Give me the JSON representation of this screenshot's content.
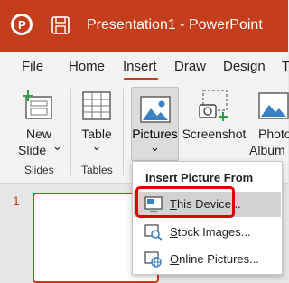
{
  "window": {
    "title": "Presentation1  -  PowerPoint"
  },
  "tabs": [
    {
      "label": "File"
    },
    {
      "label": "Home"
    },
    {
      "label": "Insert"
    },
    {
      "label": "Draw"
    },
    {
      "label": "Design"
    },
    {
      "label": "T"
    }
  ],
  "ribbon": {
    "new_slide": {
      "line1": "New",
      "line2": "Slide",
      "chevron": "⌄"
    },
    "table": {
      "label": "Table",
      "chevron": "⌄"
    },
    "pictures": {
      "label": "Pictures",
      "chevron": "⌄"
    },
    "screenshot": {
      "label": "Screenshot"
    },
    "photo_album": {
      "line1": "Photo",
      "line2": "Album"
    },
    "groups": {
      "slides": "Slides",
      "tables": "Tables"
    }
  },
  "slides": {
    "current_number": "1"
  },
  "menu": {
    "title": "Insert Picture From",
    "items": [
      {
        "key": "T",
        "rest": "his Device...",
        "icon": "this-device-icon",
        "highlighted": true
      },
      {
        "key": "S",
        "rest": "tock Images...",
        "icon": "stock-images-icon",
        "highlighted": false
      },
      {
        "key": "O",
        "rest": "nline Pictures...",
        "icon": "online-pictures-icon",
        "highlighted": false
      }
    ]
  },
  "colors": {
    "accent": "#c43e1c",
    "highlight_box": "#e00000",
    "menu_highlight": "#d2d2d2"
  }
}
